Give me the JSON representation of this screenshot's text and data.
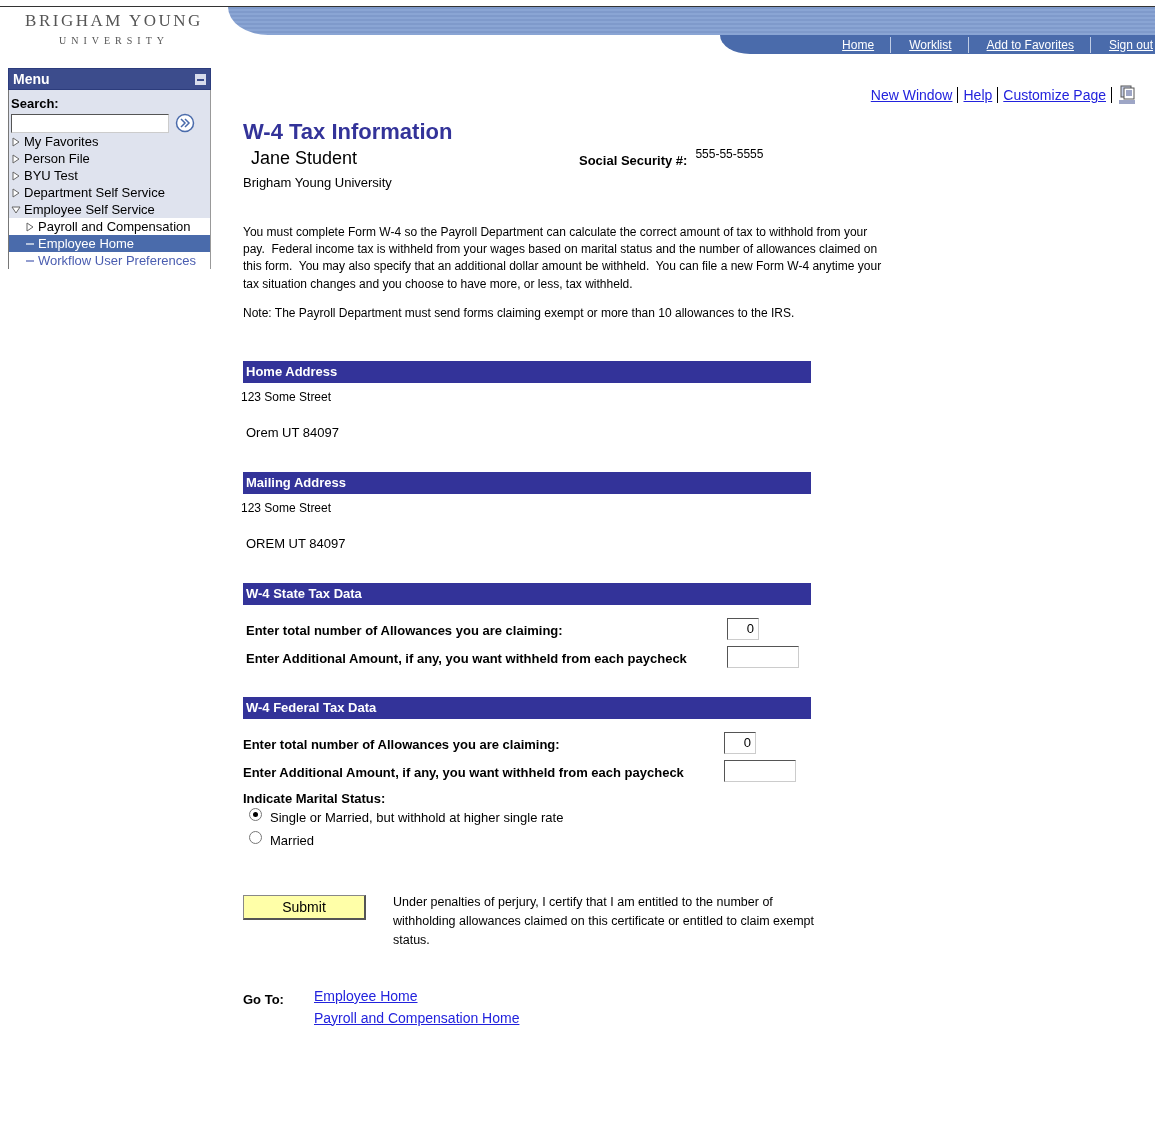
{
  "header": {
    "logo_line1": "BRIGHAM YOUNG",
    "logo_line2": "UNIVERSITY",
    "nav": [
      "Home",
      "Worklist",
      "Add to Favorites",
      "Sign out"
    ]
  },
  "menu": {
    "title": "Menu",
    "search_label": "Search:",
    "items": [
      {
        "label": "My Favorites",
        "kind": "folder",
        "expanded": false,
        "selected": false
      },
      {
        "label": "Person File",
        "kind": "folder",
        "expanded": false,
        "selected": false
      },
      {
        "label": "BYU Test",
        "kind": "folder",
        "expanded": false,
        "selected": false
      },
      {
        "label": "Department Self Service",
        "kind": "folder",
        "expanded": false,
        "selected": false
      },
      {
        "label": "Employee Self Service",
        "kind": "folder",
        "expanded": true,
        "selected": false,
        "children": [
          {
            "label": "Payroll and Compensation",
            "kind": "folder",
            "expanded": false,
            "selected": false
          },
          {
            "label": "Employee Home",
            "kind": "link",
            "selected": true
          },
          {
            "label": "Workflow User Preferences",
            "kind": "link",
            "selected": false
          }
        ]
      }
    ]
  },
  "page_links": [
    "New Window",
    "Help",
    "Customize Page"
  ],
  "title": "W-4 Tax Information",
  "employee": {
    "name": "Jane Student",
    "ssn_label": "Social Security #:",
    "ssn": "555-55-5555",
    "organization": "Brigham Young University"
  },
  "intro": "You must complete Form W-4 so the Payroll Department can calculate the correct amount of tax to withhold from your pay.  Federal income tax is withheld from your wages based on marital status and the number of allowances claimed on this form.  You may also specify that an additional dollar amount be withheld.  You can file a new Form W-4 anytime your tax situation changes and you choose to have more, or less, tax withheld.",
  "note": "Note: The Payroll Department must send forms claiming exempt or more than 10 allowances to the IRS.",
  "sections": [
    {
      "heading": "Home Address",
      "kind": "address",
      "lines": [
        "123 Some Street",
        "Orem UT 84097"
      ]
    },
    {
      "heading": "Mailing Address",
      "kind": "address",
      "lines": [
        "123 Some Street",
        "OREM UT 84097"
      ]
    },
    {
      "heading": "W-4 State Tax Data",
      "kind": "tax",
      "fields": [
        {
          "label": "Enter total number of Allowances you are claiming:",
          "value": "0"
        },
        {
          "label": "Enter Additional Amount, if any, you want withheld from each paycheck"
        }
      ]
    },
    {
      "heading": "W-4 Federal Tax Data",
      "kind": "tax",
      "fields": [
        {
          "label": "Enter total number of Allowances you are claiming:",
          "value": "0"
        },
        {
          "label": "Enter Additional Amount, if any, you want withheld from each paycheck"
        }
      ],
      "marital_status": {
        "label": "Indicate Marital Status:",
        "options": [
          {
            "label": "Single or Married, but withhold at higher single rate",
            "selected": true
          },
          {
            "label": "Married",
            "selected": false
          }
        ]
      }
    }
  ],
  "submit": "Submit",
  "certification": "Under penalties of perjury, I certify that I am entitled to the number of withholding allowances claimed on this certificate or entitled to claim exempt status.",
  "goto": {
    "label": "Go To:",
    "links": [
      "Employee Home",
      "Payroll and Compensation Home"
    ]
  }
}
